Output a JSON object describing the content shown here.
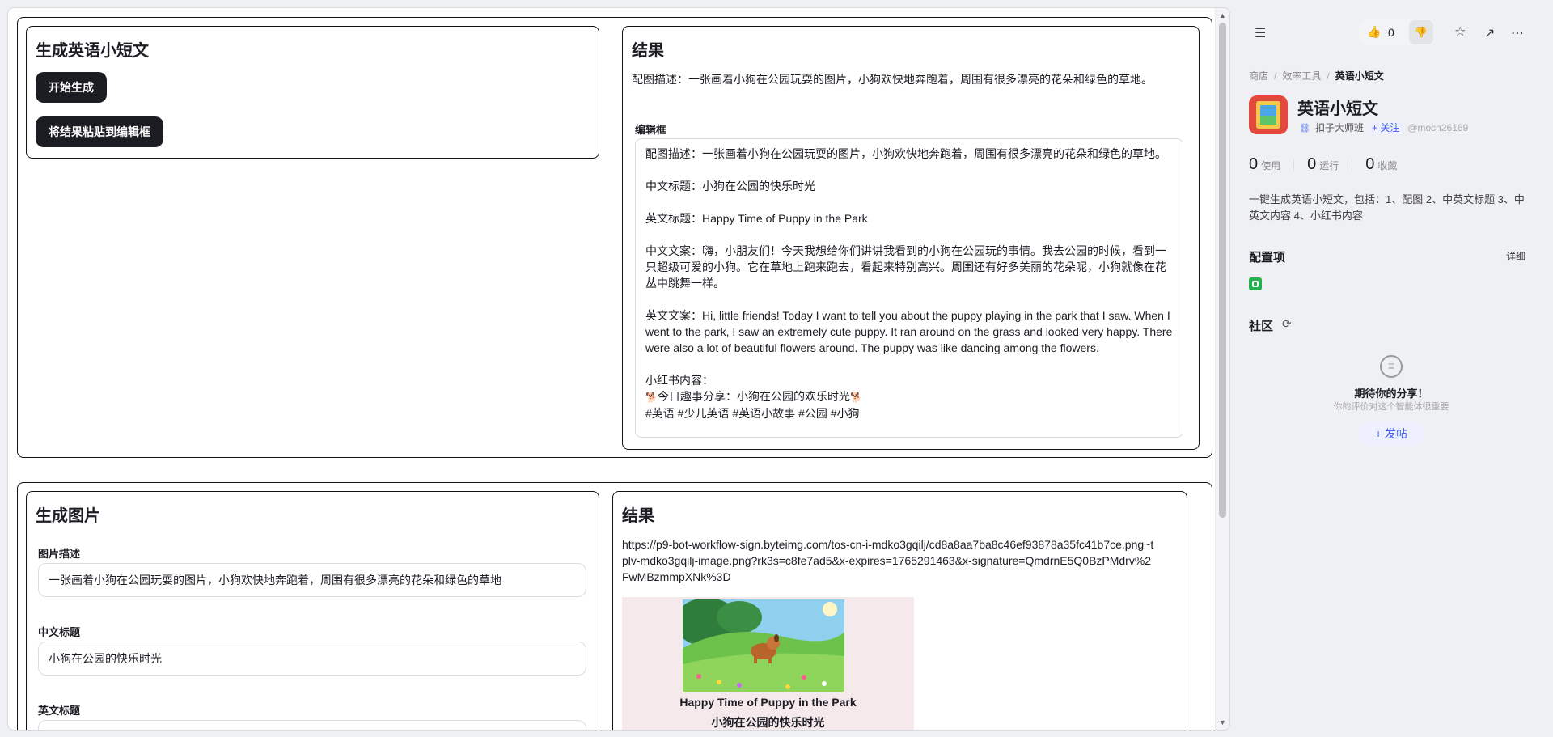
{
  "section1": {
    "left_title": "生成英语小短文",
    "buttons": [
      "开始生成",
      "将结果粘贴到编辑框"
    ],
    "result_title": "结果",
    "image_desc_line": "配图描述：一张画着小狗在公园玩耍的图片，小狗欢快地奔跑着，周围有很多漂亮的花朵和绿色的草地。",
    "editor_label": "编辑框",
    "editor": {
      "desc": "配图描述：一张画着小狗在公园玩耍的图片，小狗欢快地奔跑着，周围有很多漂亮的花朵和绿色的草地。",
      "cn_title": "中文标题：小狗在公园的快乐时光",
      "en_title": "英文标题：Happy Time of Puppy in the Park",
      "cn_text": "中文文案：嗨，小朋友们！今天我想给你们讲讲我看到的小狗在公园玩的事情。我去公园的时候，看到一只超级可爱的小狗。它在草地上跑来跑去，看起来特别高兴。周围还有好多美丽的花朵呢，小狗就像在花丛中跳舞一样。",
      "en_text": "英文文案：Hi, little friends! Today I want to tell you about the puppy playing in the park that I saw. When I went to the park, I saw an extremely cute puppy. It ran around on the grass and looked very happy. There were also a lot of beautiful flowers around. The puppy was like dancing among the flowers.",
      "xhs_label": "小红书内容：",
      "xhs_line": "今日趣事分享：小狗在公园的欢乐时光",
      "xhs_paw": "🐕",
      "xhs_tags": "#英语 #少儿英语 #英语小故事 #公园 #小狗"
    }
  },
  "section2": {
    "left_title": "生成图片",
    "fields": [
      {
        "label": "图片描述",
        "value": "一张画着小狗在公园玩耍的图片，小狗欢快地奔跑着，周围有很多漂亮的花朵和绿色的草地"
      },
      {
        "label": "中文标题",
        "value": "小狗在公园的快乐时光"
      },
      {
        "label": "英文标题",
        "value": ""
      }
    ],
    "result_title": "结果",
    "url": "https://p9-bot-workflow-sign.byteimg.com/tos-cn-i-mdko3gqilj/cd8a8aa7ba8c46ef93878a35fc41b7ce.png~tplv-mdko3gqilj-image.png?rk3s=c8fe7ad5&x-expires=1765291463&x-signature=QmdrnE5Q0BzPMdrv%2FwMBzmmpXNk%3D",
    "preview_en": "Happy Time of Puppy in the Park",
    "preview_cn": "小狗在公园的快乐时光"
  },
  "panel": {
    "like_count": "0",
    "breadcrumb": [
      "商店",
      "效率工具",
      "英语小短文"
    ],
    "app_name": "英语小短文",
    "author": "扣子大师班",
    "follow": "+ 关注",
    "handle": "@mocn26169",
    "stats": [
      {
        "value": "0",
        "label": "使用"
      },
      {
        "value": "0",
        "label": "运行"
      },
      {
        "value": "0",
        "label": "收藏"
      }
    ],
    "description": "一键生成英语小短文，包括：1、配图 2、中英文标题 3、中英文内容 4、小红书内容",
    "config_title": "配置项",
    "detail": "详细",
    "community_title": "社区",
    "empty_title": "期待你的分享！",
    "empty_sub": "你的评价对这个智能体很重要",
    "post_button": "+ 发帖"
  }
}
